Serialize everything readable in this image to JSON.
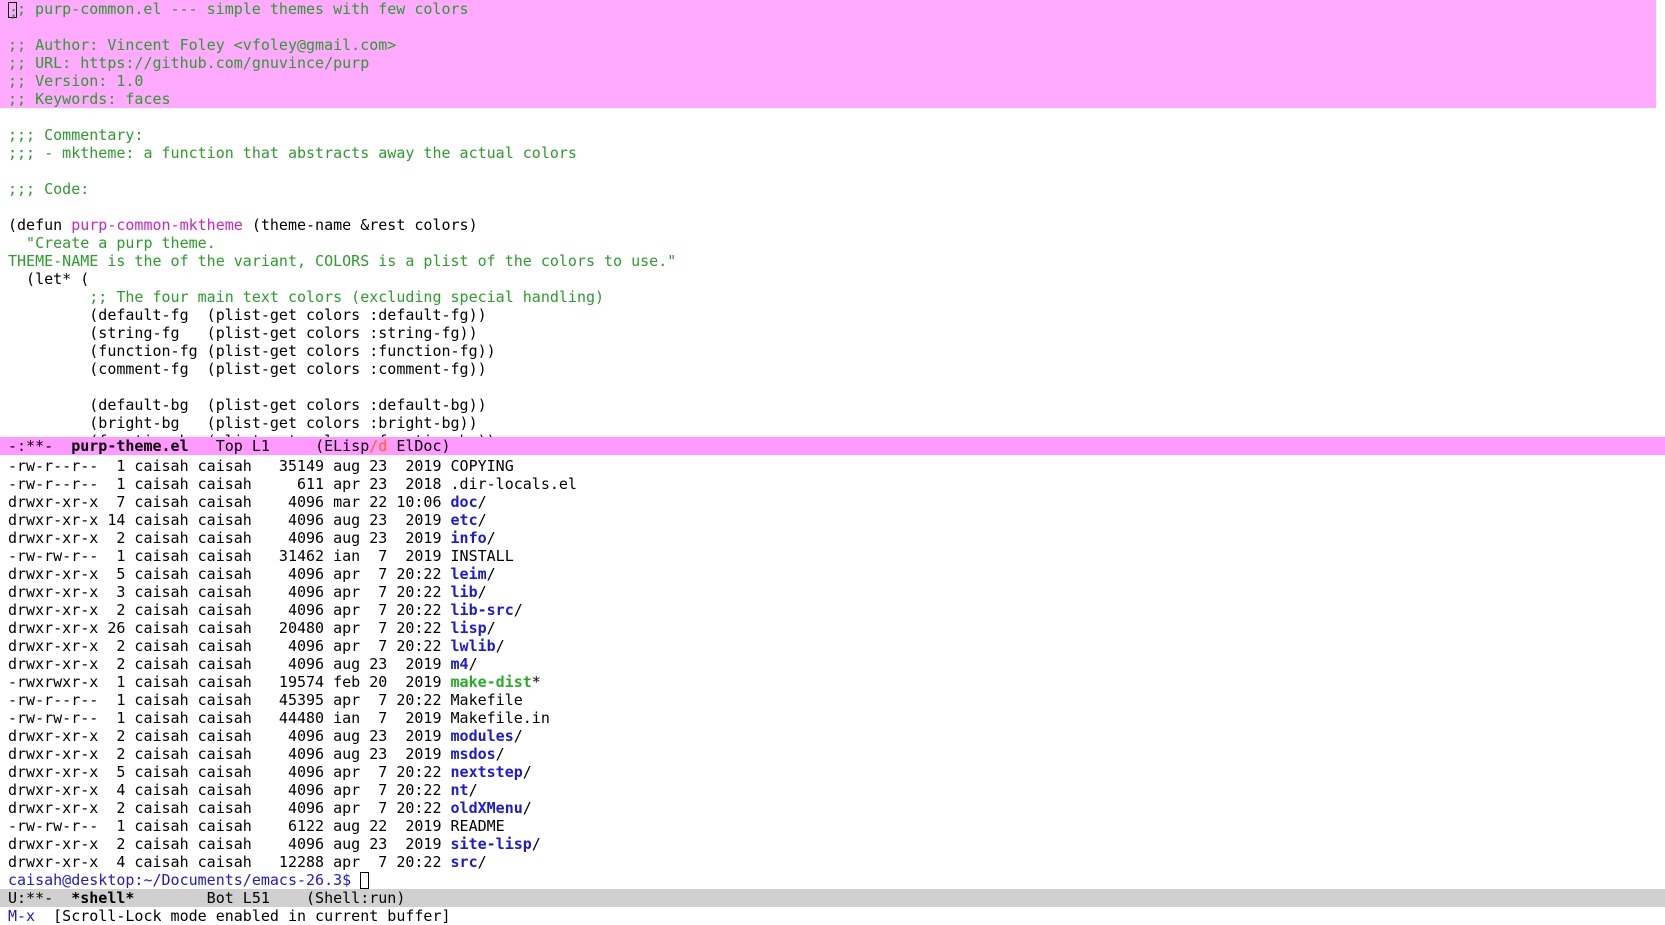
{
  "code": {
    "header_lines": [
      ";; purp-common.el --- simple themes with few colors",
      "",
      ";; Author: Vincent Foley <vfoley@gmail.com>",
      ";; URL: https://github.com/gnuvince/purp",
      ";; Version: 1.0",
      ";; Keywords: faces"
    ],
    "first_char": ";",
    "first_rest": ";; purp-common.el --- simple themes with few colors",
    "commentary_heading": ";;; Commentary:",
    "commentary_item": ";;; - mktheme: a function that abstracts away the actual colors",
    "code_heading": ";;; Code:",
    "defun_open": "(defun ",
    "defun_name": "purp-common-mktheme",
    "defun_args": " (theme-name &rest colors)",
    "doc_line1": "  \"Create a purp theme.",
    "doc_line2": "THEME-NAME is the of the variant, COLORS is a plist of the colors to use.\"",
    "let_line": "  (let* (",
    "main_colors_comment": "         ;; The four main text colors (excluding special handling)",
    "bindings": [
      "         (default-fg  (plist-get colors :default-fg))",
      "         (string-fg   (plist-get colors :string-fg))",
      "         (function-fg (plist-get colors :function-fg))",
      "         (comment-fg  (plist-get colors :comment-fg))",
      "",
      "         (default-bg  (plist-get colors :default-bg))",
      "         (bright-bg   (plist-get colors :bright-bg))",
      "         (function-bg (plist-get colors :function-bg))"
    ]
  },
  "modeline_top": {
    "status": "-:**-  ",
    "buffer": "purp-theme.el",
    "position": "   Top L1     ",
    "mode_open": "(ELisp",
    "mode_slash": "/d",
    "mode_close": " ElDoc)"
  },
  "shell": {
    "entries": [
      {
        "meta": "-rw-r--r--  1 caisah caisah   35149 aug 23  2019 ",
        "name": "COPYING",
        "kind": "file",
        "suffix": ""
      },
      {
        "meta": "-rw-r--r--  1 caisah caisah     611 apr 23  2018 ",
        "name": ".dir-locals.el",
        "kind": "file",
        "suffix": ""
      },
      {
        "meta": "drwxr-xr-x  7 caisah caisah    4096 mar 22 10:06 ",
        "name": "doc",
        "kind": "dir",
        "suffix": "/"
      },
      {
        "meta": "drwxr-xr-x 14 caisah caisah    4096 aug 23  2019 ",
        "name": "etc",
        "kind": "dir",
        "suffix": "/"
      },
      {
        "meta": "drwxr-xr-x  2 caisah caisah    4096 aug 23  2019 ",
        "name": "info",
        "kind": "dir",
        "suffix": "/"
      },
      {
        "meta": "-rw-rw-r--  1 caisah caisah   31462 ian  7  2019 ",
        "name": "INSTALL",
        "kind": "file",
        "suffix": ""
      },
      {
        "meta": "drwxr-xr-x  5 caisah caisah    4096 apr  7 20:22 ",
        "name": "leim",
        "kind": "dir",
        "suffix": "/"
      },
      {
        "meta": "drwxr-xr-x  3 caisah caisah    4096 apr  7 20:22 ",
        "name": "lib",
        "kind": "dir",
        "suffix": "/"
      },
      {
        "meta": "drwxr-xr-x  2 caisah caisah    4096 apr  7 20:22 ",
        "name": "lib-src",
        "kind": "dir",
        "suffix": "/"
      },
      {
        "meta": "drwxr-xr-x 26 caisah caisah   20480 apr  7 20:22 ",
        "name": "lisp",
        "kind": "dir",
        "suffix": "/"
      },
      {
        "meta": "drwxr-xr-x  2 caisah caisah    4096 apr  7 20:22 ",
        "name": "lwlib",
        "kind": "dir",
        "suffix": "/"
      },
      {
        "meta": "drwxr-xr-x  2 caisah caisah    4096 aug 23  2019 ",
        "name": "m4",
        "kind": "dir",
        "suffix": "/"
      },
      {
        "meta": "-rwxrwxr-x  1 caisah caisah   19574 feb 20  2019 ",
        "name": "make-dist",
        "kind": "exec",
        "suffix": "*"
      },
      {
        "meta": "-rw-r--r--  1 caisah caisah   45395 apr  7 20:22 ",
        "name": "Makefile",
        "kind": "file",
        "suffix": ""
      },
      {
        "meta": "-rw-rw-r--  1 caisah caisah   44480 ian  7  2019 ",
        "name": "Makefile.in",
        "kind": "file",
        "suffix": ""
      },
      {
        "meta": "drwxr-xr-x  2 caisah caisah    4096 aug 23  2019 ",
        "name": "modules",
        "kind": "dir",
        "suffix": "/"
      },
      {
        "meta": "drwxr-xr-x  2 caisah caisah    4096 aug 23  2019 ",
        "name": "msdos",
        "kind": "dir",
        "suffix": "/"
      },
      {
        "meta": "drwxr-xr-x  5 caisah caisah    4096 apr  7 20:22 ",
        "name": "nextstep",
        "kind": "dir",
        "suffix": "/"
      },
      {
        "meta": "drwxr-xr-x  4 caisah caisah    4096 apr  7 20:22 ",
        "name": "nt",
        "kind": "dir",
        "suffix": "/"
      },
      {
        "meta": "drwxr-xr-x  2 caisah caisah    4096 apr  7 20:22 ",
        "name": "oldXMenu",
        "kind": "dir",
        "suffix": "/"
      },
      {
        "meta": "-rw-rw-r--  1 caisah caisah    6122 aug 22  2019 ",
        "name": "README",
        "kind": "file",
        "suffix": ""
      },
      {
        "meta": "drwxr-xr-x  2 caisah caisah    4096 aug 23  2019 ",
        "name": "site-lisp",
        "kind": "dir",
        "suffix": "/"
      },
      {
        "meta": "drwxr-xr-x  4 caisah caisah   12288 apr  7 20:22 ",
        "name": "src",
        "kind": "dir",
        "suffix": "/"
      }
    ],
    "prompt": "caisah@desktop:~/Documents/emacs-26.3$ "
  },
  "modeline_bottom": {
    "status": "U:**-  ",
    "buffer": "*shell*",
    "position": "        Bot L51    ",
    "mode": "(Shell:run)"
  },
  "minibuffer": {
    "key": "M-x",
    "message": "  [Scroll-Lock mode enabled in current buffer]"
  },
  "colors": {
    "header_highlight": "#ffaaff",
    "modeline_active": "#ff99ff",
    "modeline_inactive": "#d0d0d0",
    "comment": "#2a9d2a",
    "function_name": "#d21fd2",
    "directory": "#1a1ad8",
    "executable": "#22b022"
  }
}
